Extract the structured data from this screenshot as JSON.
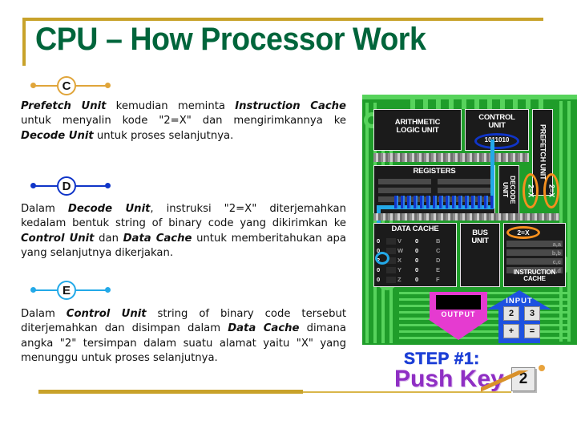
{
  "slide": {
    "title": "CPU – How Processor Work",
    "accent_gold": "#c8a22a",
    "title_color": "#00653b"
  },
  "bullets": [
    {
      "letter": "C",
      "color": "#e0a53a",
      "paragraph": {
        "runs": [
          {
            "text": "Prefetch Unit",
            "bold": true
          },
          {
            "text": " kemudian meminta ",
            "bold": false
          },
          {
            "text": "Instruction Cache",
            "bold": true
          },
          {
            "text": " untuk menyalin kode \"2=X\" dan mengirimkannya ke ",
            "bold": false
          },
          {
            "text": "Decode Unit",
            "bold": true
          },
          {
            "text": " untuk proses selanjutnya.",
            "bold": false
          }
        ]
      }
    },
    {
      "letter": "D",
      "color": "#1035c8",
      "paragraph": {
        "runs": [
          {
            "text": "Dalam ",
            "bold": false
          },
          {
            "text": "Decode Unit",
            "bold": true
          },
          {
            "text": ", instruksi \"2=X\" diterjemahkan kedalam bentuk  string of binary code  yang dikirimkan ke ",
            "bold": false
          },
          {
            "text": "Control Unit",
            "bold": true
          },
          {
            "text": " dan ",
            "bold": false
          },
          {
            "text": "Data Cache",
            "bold": true
          },
          {
            "text": " untuk memberitahukan apa yang selanjutnya dikerjakan.",
            "bold": false
          }
        ]
      }
    },
    {
      "letter": "E",
      "color": "#23a9e8",
      "paragraph": {
        "runs": [
          {
            "text": "Dalam ",
            "bold": false
          },
          {
            "text": "Control Unit",
            "bold": true
          },
          {
            "text": " string of binary code tersebut diterjemahkan dan disimpan dalam ",
            "bold": false
          },
          {
            "text": "Data Cache",
            "bold": true
          },
          {
            "text": " dimana angka \"2\" tersimpan dalam suatu alamat yaitu \"X\" yang menunggu untuk proses selanjutnya.",
            "bold": false
          }
        ]
      }
    }
  ],
  "diagram": {
    "alu_label": "ARITHMETIC\nLOGIC UNIT",
    "control_unit_label": "CONTROL\nUNIT",
    "binary_code": "1011010",
    "prefetch_unit_label": "PREFETCH UNIT",
    "registers_label": "REGISTERS",
    "decode_unit_label": "DECODE\nUNIT",
    "decode_tag_1": "2=X",
    "decode_tag_2": "2=X",
    "data_cache_label": "DATA CACHE",
    "data_cache_rows": [
      {
        "v1": "0",
        "k1": "V",
        "v2": "0",
        "k2": "B"
      },
      {
        "v1": "0",
        "k1": "W",
        "v2": "0",
        "k2": "C"
      },
      {
        "v1": "2",
        "k1": "X",
        "v2": "0",
        "k2": "D"
      },
      {
        "v1": "0",
        "k1": "Y",
        "v2": "0",
        "k2": "E"
      },
      {
        "v1": "0",
        "k1": "Z",
        "v2": "0",
        "k2": "F"
      }
    ],
    "bus_unit_label": "BUS\nUNIT",
    "instruction_tag": "2=X",
    "instruction_cache_rows": [
      "a,a",
      "b,b",
      "c,c",
      "d,d"
    ],
    "instruction_cache_label": "INSTRUCTION\nCACHE",
    "output_label": "OUTPUT",
    "input_label": "INPUT",
    "input_keys": [
      "2",
      "3",
      "+",
      "="
    ],
    "highlight_orange": "#f5901e",
    "highlight_cyan": "#23a9e8",
    "board_green": "#1f9d2a"
  },
  "step": {
    "label": "STEP #1:",
    "title": "Push Key",
    "key": "2",
    "label_color": "#1c3fd6",
    "title_color": "#8f2fc4"
  }
}
